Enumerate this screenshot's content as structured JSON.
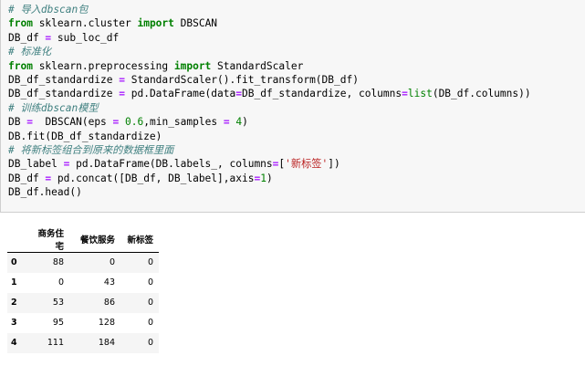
{
  "code_lines": [
    [
      {
        "t": "# 导入dbscan包",
        "k": "cm"
      }
    ],
    [
      {
        "t": "from",
        "k": "kw"
      },
      {
        "t": " sklearn.cluster ",
        "k": "tx"
      },
      {
        "t": "import",
        "k": "kw"
      },
      {
        "t": " DBSCAN",
        "k": "tx"
      }
    ],
    [
      {
        "t": "DB_df ",
        "k": "tx"
      },
      {
        "t": "=",
        "k": "op"
      },
      {
        "t": " sub_loc_df",
        "k": "tx"
      }
    ],
    [
      {
        "t": "# 标准化",
        "k": "cm"
      }
    ],
    [
      {
        "t": "from",
        "k": "kw"
      },
      {
        "t": " sklearn.preprocessing ",
        "k": "tx"
      },
      {
        "t": "import",
        "k": "kw"
      },
      {
        "t": " StandardScaler",
        "k": "tx"
      }
    ],
    [
      {
        "t": "DB_df_standardize ",
        "k": "tx"
      },
      {
        "t": "=",
        "k": "op"
      },
      {
        "t": " StandardScaler().fit_transform(DB_df)",
        "k": "tx"
      }
    ],
    [
      {
        "t": "DB_df_standardize ",
        "k": "tx"
      },
      {
        "t": "=",
        "k": "op"
      },
      {
        "t": " pd.DataFrame(data",
        "k": "tx"
      },
      {
        "t": "=",
        "k": "op"
      },
      {
        "t": "DB_df_standardize, columns",
        "k": "tx"
      },
      {
        "t": "=",
        "k": "op"
      },
      {
        "t": "list",
        "k": "bi"
      },
      {
        "t": "(DB_df.columns))",
        "k": "tx"
      }
    ],
    [
      {
        "t": "# 训练dbscan模型",
        "k": "cm"
      }
    ],
    [
      {
        "t": "DB ",
        "k": "tx"
      },
      {
        "t": "=",
        "k": "op"
      },
      {
        "t": "  DBSCAN(eps ",
        "k": "tx"
      },
      {
        "t": "=",
        "k": "op"
      },
      {
        "t": " ",
        "k": "tx"
      },
      {
        "t": "0.6",
        "k": "nu"
      },
      {
        "t": ",min_samples ",
        "k": "tx"
      },
      {
        "t": "=",
        "k": "op"
      },
      {
        "t": " ",
        "k": "tx"
      },
      {
        "t": "4",
        "k": "nu"
      },
      {
        "t": ")",
        "k": "tx"
      }
    ],
    [
      {
        "t": "DB.fit(DB_df_standardize)",
        "k": "tx"
      }
    ],
    [
      {
        "t": "# 将新标签组合到原来的数据框里面",
        "k": "cm"
      }
    ],
    [
      {
        "t": "DB_label ",
        "k": "tx"
      },
      {
        "t": "=",
        "k": "op"
      },
      {
        "t": " pd.DataFrame(DB.labels_, columns",
        "k": "tx"
      },
      {
        "t": "=",
        "k": "op"
      },
      {
        "t": "[",
        "k": "tx"
      },
      {
        "t": "'新标签'",
        "k": "st"
      },
      {
        "t": "])",
        "k": "tx"
      }
    ],
    [
      {
        "t": "DB_df ",
        "k": "tx"
      },
      {
        "t": "=",
        "k": "op"
      },
      {
        "t": " pd.concat([DB_df, DB_label],axis",
        "k": "tx"
      },
      {
        "t": "=",
        "k": "op"
      },
      {
        "t": "1",
        "k": "nu"
      },
      {
        "t": ")",
        "k": "tx"
      }
    ],
    [
      {
        "t": "DB_df.head()",
        "k": "tx"
      }
    ]
  ],
  "table": {
    "columns": [
      "商务住宅",
      "餐饮服务",
      "新标签"
    ],
    "index": [
      "0",
      "1",
      "2",
      "3",
      "4"
    ],
    "rows": [
      [
        "88",
        "0",
        "0"
      ],
      [
        "0",
        "43",
        "0"
      ],
      [
        "53",
        "86",
        "0"
      ],
      [
        "95",
        "128",
        "0"
      ],
      [
        "111",
        "184",
        "0"
      ]
    ]
  },
  "colors": {
    "cell_background": "#f7f7f7",
    "comment": "#408080",
    "keyword": "#008000",
    "operator": "#aa22ff",
    "string": "#ba2121"
  }
}
